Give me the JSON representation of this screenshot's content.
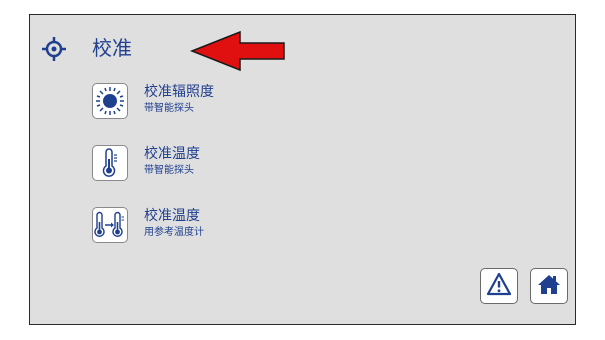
{
  "header": {
    "title": "校准",
    "icon": "crosshair-icon"
  },
  "menu": {
    "items": [
      {
        "title": "校准辐照度",
        "subtitle": "带智能探头",
        "icon": "sun-icon"
      },
      {
        "title": "校准温度",
        "subtitle": "带智能探头",
        "icon": "thermometer-icon"
      },
      {
        "title": "校准温度",
        "subtitle": "用参考温度计",
        "icon": "thermometer-compare-icon"
      }
    ]
  },
  "footer": {
    "warning_icon": "warning-icon",
    "home_icon": "home-icon"
  },
  "colors": {
    "accent": "#1f3f8f",
    "arrow": "#e01010",
    "background": "#dfdfdf"
  }
}
